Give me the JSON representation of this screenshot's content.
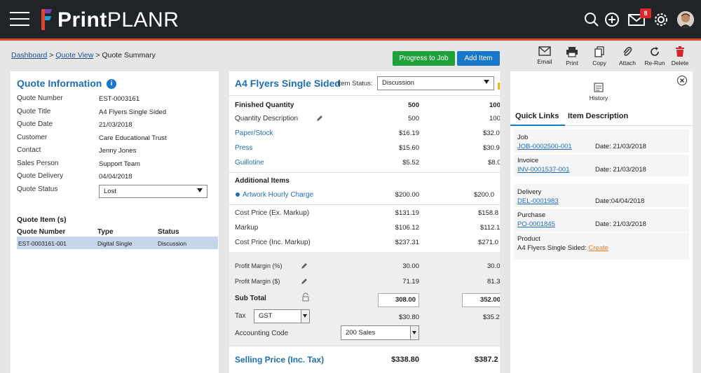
{
  "app": {
    "logo_bold": "Print",
    "logo_thin": "PLANR",
    "notification_count": "8"
  },
  "breadcrumb": {
    "dashboard": "Dashboard",
    "quote_view": "Quote View",
    "current": "Quote Summary",
    "sep": ">"
  },
  "actions": {
    "progress_to_job": "Progress to Job",
    "add_item": "Add Item"
  },
  "toolbar": {
    "email": "Email",
    "print": "Print",
    "copy": "Copy",
    "attach": "Attach",
    "rerun": "Re-Run",
    "delete": "Delete"
  },
  "quote_info": {
    "title": "Quote Information",
    "fields": [
      {
        "label": "Quote Number",
        "value": "EST-0003161"
      },
      {
        "label": "Quote Title",
        "value": "A4 Flyers Single Sided"
      },
      {
        "label": "Quote Date",
        "value": "21/03/2018"
      },
      {
        "label": "Customer",
        "value": "Care Educational Trust"
      },
      {
        "label": "Contact",
        "value": "Jenny Jones"
      },
      {
        "label": "Sales Person",
        "value": "Support Team"
      },
      {
        "label": "Quote Delivery",
        "value": "04/04/2018"
      }
    ],
    "status_label": "Quote Status",
    "status_value": "Lost"
  },
  "quote_items": {
    "title": "Quote Item (s)",
    "headers": [
      "Quote Number",
      "Type",
      "Status"
    ],
    "rows": [
      {
        "number": "EST-0003161-001",
        "type": "Digital Single",
        "status": "Discussion"
      }
    ]
  },
  "item": {
    "title": "A4 Flyers Single Sided",
    "status_label": "Item Status:",
    "status_value": "Discussion",
    "finished_quantity": {
      "label": "Finished Quantity",
      "q1": "500",
      "q2": "100"
    },
    "quantity_description": {
      "label": "Quantity Description",
      "q1": "500",
      "q2": "100"
    },
    "paper": {
      "label": "Paper/Stock",
      "q1": "$16.19",
      "q2": "$32.0"
    },
    "press": {
      "label": "Press",
      "q1": "$15.60",
      "q2": "$30.9"
    },
    "guillotine": {
      "label": "Guillotine",
      "q1": "$5.52",
      "q2": "$8.0"
    },
    "additional_items": "Additional Items",
    "artwork": {
      "label": "Artwork Hourly Charge",
      "q1": "$200.00",
      "q2": "$200.0"
    },
    "cost_ex": {
      "label": "Cost Price (Ex. Markup)",
      "q1": "$131.19",
      "q2": "$158.8"
    },
    "markup": {
      "label": "Markup",
      "q1": "$106.12",
      "q2": "$112.1"
    },
    "cost_inc": {
      "label": "Cost Price (Inc. Markup)",
      "q1": "$237.31",
      "q2": "$271.0"
    },
    "margin_pct": {
      "label": "Profit Margin (%)",
      "q1": "30.00",
      "q2": "30.0"
    },
    "margin_amt": {
      "label": "Profit Margin ($)",
      "q1": "71.19",
      "q2": "81.3"
    },
    "sub_total": {
      "label": "Sub Total",
      "q1": "308.00",
      "q2": "352.00"
    },
    "tax": {
      "label": "Tax",
      "select": "GST",
      "q1": "$30.80",
      "q2": "$35.2"
    },
    "accounting": {
      "label": "Accounting Code",
      "select": "200 Sales"
    },
    "selling": {
      "label": "Selling Price (Inc. Tax)",
      "q1": "$338.80",
      "q2": "$387.2"
    }
  },
  "side": {
    "history": "History",
    "tab_quick_links": "Quick Links",
    "tab_item_description": "Item Description",
    "links": {
      "job_label": "Job",
      "job_link": "JOB-0002500-001",
      "job_date": "Date: 21/03/2018",
      "invoice_label": "Invoice",
      "invoice_link": "INV-0001537-001",
      "invoice_date": "Date: 21/03/2018",
      "delivery_label": "Delivery",
      "delivery_link": "DEL-0001983",
      "delivery_date": "Date:04/04/2018",
      "purchase_label": "Purchase",
      "purchase_link": "PO-0001845",
      "purchase_date": "Date: 21/03/2018",
      "product_label": "Product",
      "product_text": "A4 Flyers Single Sided:",
      "product_create": "Create"
    }
  }
}
